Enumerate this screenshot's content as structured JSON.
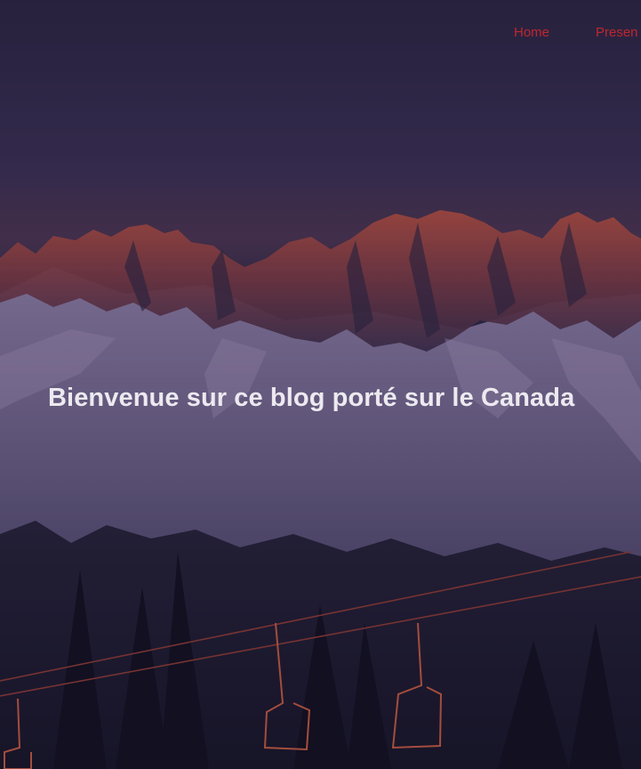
{
  "nav": {
    "items": [
      {
        "label": "Home"
      },
      {
        "label": "Presen"
      }
    ]
  },
  "hero": {
    "title": "Bienvenue sur ce blog porté sur le Canada",
    "background_image": "snowy-mountains-sunset-ski-lift"
  },
  "colors": {
    "nav_link": "#c0262e",
    "title": "#ece9f0",
    "sky": "#2b2440"
  }
}
